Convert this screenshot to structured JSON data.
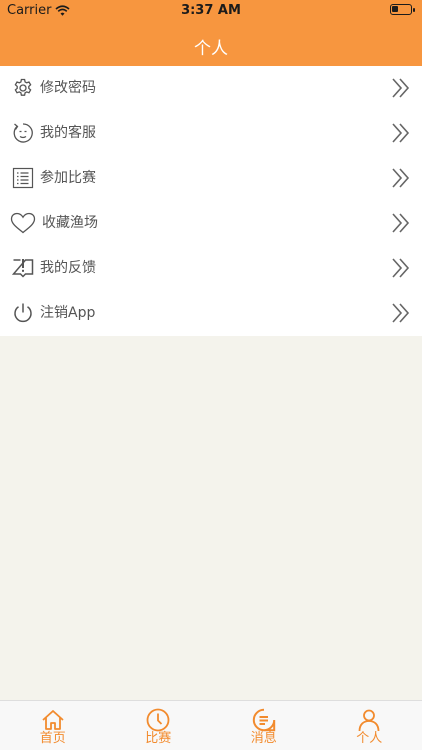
{
  "status_bar": {
    "carrier": "Carrier",
    "time": "3:37 AM"
  },
  "header": {
    "title": "个人"
  },
  "menu": {
    "items": [
      {
        "label": "修改密码",
        "icon": "gear-icon"
      },
      {
        "label": "我的客服",
        "icon": "customer-service-icon"
      },
      {
        "label": "参加比赛",
        "icon": "list-icon"
      },
      {
        "label": "收藏渔场",
        "icon": "heart-icon"
      },
      {
        "label": "我的反馈",
        "icon": "feedback-book-icon"
      },
      {
        "label": "注销App",
        "icon": "power-icon"
      }
    ]
  },
  "tabbar": {
    "tabs": [
      {
        "label": "首页",
        "icon": "home-icon"
      },
      {
        "label": "比赛",
        "icon": "clock-icon"
      },
      {
        "label": "消息",
        "icon": "message-icon"
      },
      {
        "label": "个人",
        "icon": "person-icon"
      }
    ]
  },
  "colors": {
    "accent": "#f7963f",
    "tab_active": "#f28b2e",
    "background": "#f4f3ec"
  }
}
